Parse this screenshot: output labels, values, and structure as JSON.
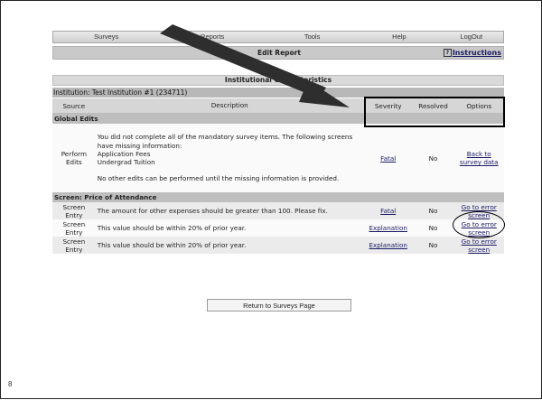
{
  "slide_number": "8",
  "menu": [
    "Surveys",
    "Reports",
    "Tools",
    "Help",
    "LogOut"
  ],
  "titlebar": {
    "title": "Edit Report",
    "instructions": "Instructions",
    "instructions_icon": "?"
  },
  "section_title": "Institutional Characteristics",
  "institution_line": "Institution: Test Institution #1 (234711)",
  "columns": {
    "source": "Source",
    "description": "Description",
    "severity": "Severity",
    "resolved": "Resolved",
    "options": "Options"
  },
  "groups": [
    {
      "label": "Global Edits",
      "rows": [
        {
          "source": "Perform Edits",
          "description": [
            "You did not complete all of the mandatory survey items. The following screens have missing information:",
            "Application Fees",
            "Undergrad Tuition",
            "",
            "No other edits can be performed until the missing information is provided."
          ],
          "severity": "Fatal",
          "resolved": "No",
          "option": "Back to survey data"
        }
      ]
    },
    {
      "label": "Screen: Price of Attendance",
      "rows": [
        {
          "source": "Screen Entry",
          "description": [
            "The amount for other expenses should be greater than 100. Please fix."
          ],
          "severity": "Fatal",
          "resolved": "No",
          "option": "Go to error screen"
        },
        {
          "source": "Screen Entry",
          "description": [
            "This value should be within 20% of prior year."
          ],
          "severity": "Explanation",
          "resolved": "No",
          "option": "Go to error screen"
        },
        {
          "source": "Screen Entry",
          "description": [
            "This value should be within 20% of prior year."
          ],
          "severity": "Explanation",
          "resolved": "No",
          "option": "Go to error screen"
        }
      ]
    }
  ],
  "return_button": "Return to Surveys Page",
  "colors": {
    "link": "#1a1a66",
    "title_bg": "#c9c9c9",
    "group_bg": "#bebebe",
    "annotation": "#000000"
  }
}
